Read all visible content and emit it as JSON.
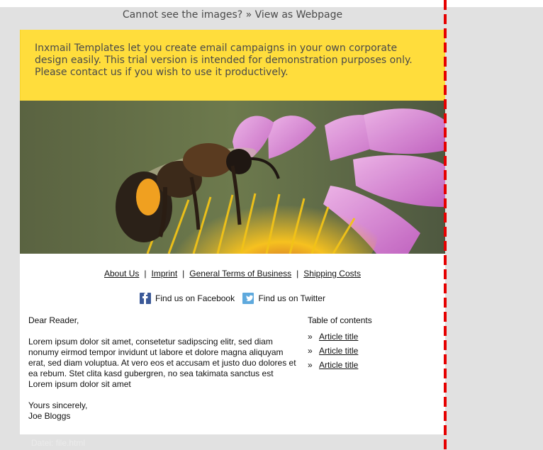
{
  "header": {
    "preheader": "Cannot see the images? » View as Webpage"
  },
  "banner": {
    "text": "Inxmail Templates let you create email campaigns in your own corporate design easily. This trial version is intended for demonstration purposes only. Please contact us if you wish to use it productively."
  },
  "hero": {
    "image_label": "bee on flower"
  },
  "nav": {
    "items": [
      "About Us",
      "Imprint",
      "General Terms of Business",
      "Shipping Costs"
    ],
    "separator": "|"
  },
  "social": {
    "facebook": "Find us on Facebook",
    "twitter": "Find us on Twitter"
  },
  "content": {
    "salutation": "Dear Reader,",
    "body": "Lorem ipsum dolor sit amet, consetetur sadipscing elitr, sed diam nonumy eirmod tempor invidunt ut labore et dolore magna aliquyam erat, sed diam voluptua. At vero eos et accusam et justo duo dolores et ea rebum. Stet clita kasd gubergren, no sea takimata sanctus est Lorem ipsum dolor sit amet",
    "closing_line": "Yours sincerely,",
    "signature": "Joe Bloggs"
  },
  "toc": {
    "title": "Table of contents",
    "arrow": "»",
    "items": [
      "Article title",
      "Article title",
      "Article title"
    ]
  },
  "footer": {
    "ghost_text": "Datei: file.html"
  },
  "colors": {
    "banner": "#ffdd3c",
    "page_bg": "#e1e1e1",
    "guide": "#e60000"
  }
}
